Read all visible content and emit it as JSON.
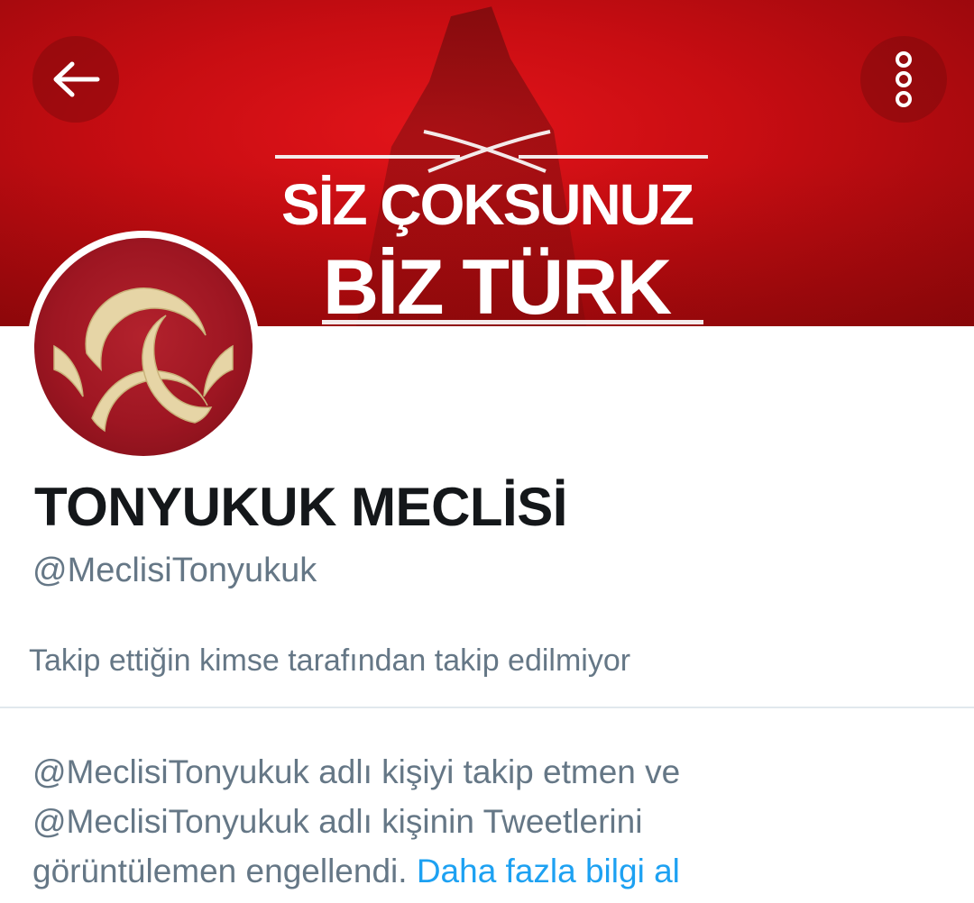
{
  "banner": {
    "line1": "SİZ ÇOKSUNUZ",
    "line2": "BİZ TÜRK"
  },
  "toolbar": {
    "back_icon": "arrow-left-icon",
    "more_icon": "vertical-dots-icon"
  },
  "profile": {
    "name": "TONYUKUK MECLİSİ",
    "handle": "@MeclisiTonyukuk",
    "follow_context": "Takip ettiğin kimse tarafından takip edilmiyor"
  },
  "blocked_notice": {
    "line1": "@MeclisiTonyukuk adlı kişiyi takip etmen ve",
    "line2": "@MeclisiTonyukuk adlı kişinin Tweetlerini",
    "line3_text": "görüntülemen engellendi. ",
    "link": "Daha fazla bilgi al"
  },
  "colors": {
    "banner_red": "#c80d12",
    "avatar_red": "#9e1622",
    "emblem_gold": "#e6d5a6",
    "link_blue": "#1da1f2",
    "secondary_text": "#657786",
    "primary_text": "#14171a"
  }
}
